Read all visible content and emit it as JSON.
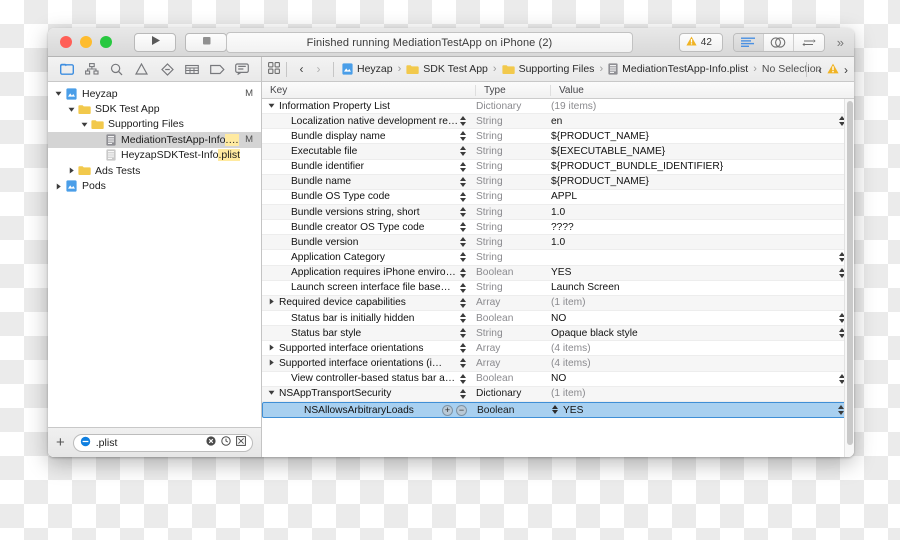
{
  "window": {
    "title_status": "Finished running MediationTestApp on iPhone (2)",
    "warning_count": "42",
    "overflow_chevron": "»"
  },
  "navigator": {
    "toolbar_icons": [
      "folder-icon",
      "hierarchy-icon",
      "search-icon",
      "warning-triangle-icon",
      "issue-icon",
      "test-grid-icon",
      "tag-icon",
      "report-icon"
    ],
    "tree": [
      {
        "indent": 0,
        "disclosure": "down",
        "icon": "project-icon",
        "label": "Heyzap",
        "modified": "M",
        "selected": false,
        "highlight": ""
      },
      {
        "indent": 1,
        "disclosure": "down",
        "icon": "folder-icon",
        "label": "SDK Test App",
        "modified": "",
        "selected": false,
        "highlight": ""
      },
      {
        "indent": 2,
        "disclosure": "down",
        "icon": "folder-icon",
        "label": "Supporting Files",
        "modified": "",
        "selected": false,
        "highlight": ""
      },
      {
        "indent": 3,
        "disclosure": "none",
        "icon": "plist-icon",
        "label": "MediationTestApp-Info",
        "modified": "M",
        "selected": true,
        "highlight": ".plist"
      },
      {
        "indent": 3,
        "disclosure": "none",
        "icon": "plist-dim-icon",
        "label": "HeyzapSDKTest-Info",
        "modified": "",
        "selected": false,
        "highlight": ".plist"
      },
      {
        "indent": 1,
        "disclosure": "right",
        "icon": "folder-icon",
        "label": "Ads Tests",
        "modified": "",
        "selected": false,
        "highlight": ""
      },
      {
        "indent": 0,
        "disclosure": "right",
        "icon": "project-icon",
        "label": "Pods",
        "modified": "",
        "selected": false,
        "highlight": ""
      }
    ],
    "filter": {
      "add_label": "+",
      "scope_icon": "filter-scope-icon",
      "value": ".plist",
      "clear_icon": "clear-icon",
      "recent_icon": "clock-icon",
      "source_icon": "source-control-icon"
    }
  },
  "jumpbar": {
    "grid_icon": "related-items-icon",
    "back": "‹",
    "forward": "›",
    "crumbs": [
      {
        "icon": "project-icon",
        "label": "Heyzap"
      },
      {
        "icon": "folder-icon",
        "label": "SDK Test App"
      },
      {
        "icon": "folder-icon",
        "label": "Supporting Files"
      },
      {
        "icon": "plist-icon",
        "label": "MediationTestApp-Info.plist"
      },
      {
        "icon": "",
        "label": "No Selection"
      }
    ],
    "issue_prev": "‹",
    "issue_icon": "warning-triangle-icon",
    "issue_next": "›"
  },
  "plist": {
    "columns": [
      "Key",
      "Type",
      "Value"
    ],
    "rows": [
      {
        "indent": 0,
        "disclosure": "down",
        "key": "Information Property List",
        "type": "Dictionary",
        "type_solid": false,
        "value": "(19 items)",
        "value_dim": true,
        "value_bold": false,
        "key_stepper": false,
        "value_stepper": false
      },
      {
        "indent": 1,
        "disclosure": "none",
        "key": "Localization native development re…",
        "type": "String",
        "type_solid": false,
        "value": "en",
        "value_dim": false,
        "value_bold": false,
        "key_stepper": true,
        "value_stepper": true
      },
      {
        "indent": 1,
        "disclosure": "none",
        "key": "Bundle display name",
        "type": "String",
        "type_solid": false,
        "value": "${PRODUCT_NAME}",
        "value_dim": false,
        "value_bold": false,
        "key_stepper": true,
        "value_stepper": false
      },
      {
        "indent": 1,
        "disclosure": "none",
        "key": "Executable file",
        "type": "String",
        "type_solid": false,
        "value": "${EXECUTABLE_NAME}",
        "value_dim": false,
        "value_bold": false,
        "key_stepper": true,
        "value_stepper": false
      },
      {
        "indent": 1,
        "disclosure": "none",
        "key": "Bundle identifier",
        "type": "String",
        "type_solid": false,
        "value": "${PRODUCT_BUNDLE_IDENTIFIER}",
        "value_dim": false,
        "value_bold": false,
        "key_stepper": true,
        "value_stepper": false
      },
      {
        "indent": 1,
        "disclosure": "none",
        "key": "Bundle name",
        "type": "String",
        "type_solid": false,
        "value": "${PRODUCT_NAME}",
        "value_dim": false,
        "value_bold": false,
        "key_stepper": true,
        "value_stepper": false
      },
      {
        "indent": 1,
        "disclosure": "none",
        "key": "Bundle OS Type code",
        "type": "String",
        "type_solid": false,
        "value": "APPL",
        "value_dim": false,
        "value_bold": false,
        "key_stepper": true,
        "value_stepper": false
      },
      {
        "indent": 1,
        "disclosure": "none",
        "key": "Bundle versions string, short",
        "type": "String",
        "type_solid": false,
        "value": "1.0",
        "value_dim": false,
        "value_bold": false,
        "key_stepper": true,
        "value_stepper": false
      },
      {
        "indent": 1,
        "disclosure": "none",
        "key": "Bundle creator OS Type code",
        "type": "String",
        "type_solid": false,
        "value": "????",
        "value_dim": false,
        "value_bold": false,
        "key_stepper": true,
        "value_stepper": false
      },
      {
        "indent": 1,
        "disclosure": "none",
        "key": "Bundle version",
        "type": "String",
        "type_solid": false,
        "value": "1.0",
        "value_dim": false,
        "value_bold": false,
        "key_stepper": true,
        "value_stepper": false
      },
      {
        "indent": 1,
        "disclosure": "none",
        "key": "Application Category",
        "type": "String",
        "type_solid": false,
        "value": "",
        "value_dim": false,
        "value_bold": false,
        "key_stepper": true,
        "value_stepper": true
      },
      {
        "indent": 1,
        "disclosure": "none",
        "key": "Application requires iPhone enviro…",
        "type": "Boolean",
        "type_solid": false,
        "value": "YES",
        "value_dim": false,
        "value_bold": false,
        "key_stepper": true,
        "value_stepper": true
      },
      {
        "indent": 1,
        "disclosure": "none",
        "key": "Launch screen interface file base…",
        "type": "String",
        "type_solid": false,
        "value": "Launch Screen",
        "value_dim": false,
        "value_bold": false,
        "key_stepper": true,
        "value_stepper": false
      },
      {
        "indent": 0,
        "disclosure": "right",
        "key": "Required device capabilities",
        "type": "Array",
        "type_solid": false,
        "value": "(1 item)",
        "value_dim": true,
        "value_bold": false,
        "key_stepper": true,
        "value_stepper": false
      },
      {
        "indent": 1,
        "disclosure": "none",
        "key": "Status bar is initially hidden",
        "type": "Boolean",
        "type_solid": false,
        "value": "NO",
        "value_dim": false,
        "value_bold": false,
        "key_stepper": true,
        "value_stepper": true
      },
      {
        "indent": 1,
        "disclosure": "none",
        "key": "Status bar style",
        "type": "String",
        "type_solid": false,
        "value": "Opaque black style",
        "value_dim": false,
        "value_bold": false,
        "key_stepper": true,
        "value_stepper": true
      },
      {
        "indent": 0,
        "disclosure": "right",
        "key": "Supported interface orientations",
        "type": "Array",
        "type_solid": false,
        "value": "(4 items)",
        "value_dim": true,
        "value_bold": false,
        "key_stepper": true,
        "value_stepper": false
      },
      {
        "indent": 0,
        "disclosure": "right",
        "key": "Supported interface orientations (i…",
        "type": "Array",
        "type_solid": false,
        "value": "(4 items)",
        "value_dim": true,
        "value_bold": false,
        "key_stepper": true,
        "value_stepper": false
      },
      {
        "indent": 1,
        "disclosure": "none",
        "key": "View controller-based status bar a…",
        "type": "Boolean",
        "type_solid": false,
        "value": "NO",
        "value_dim": false,
        "value_bold": false,
        "key_stepper": true,
        "value_stepper": true
      },
      {
        "indent": 0,
        "disclosure": "down",
        "key": "NSAppTransportSecurity",
        "type": "Dictionary",
        "type_solid": true,
        "value": "(1 item)",
        "value_dim": true,
        "value_bold": false,
        "key_stepper": true,
        "value_stepper": false
      },
      {
        "indent": 2,
        "disclosure": "none",
        "key": "NSAllowsArbitraryLoads",
        "type": "Boolean",
        "type_solid": true,
        "value": "YES",
        "value_dim": false,
        "value_bold": false,
        "key_stepper": false,
        "value_stepper": true,
        "selected": true,
        "add_label": "+",
        "remove_label": "−"
      }
    ]
  }
}
